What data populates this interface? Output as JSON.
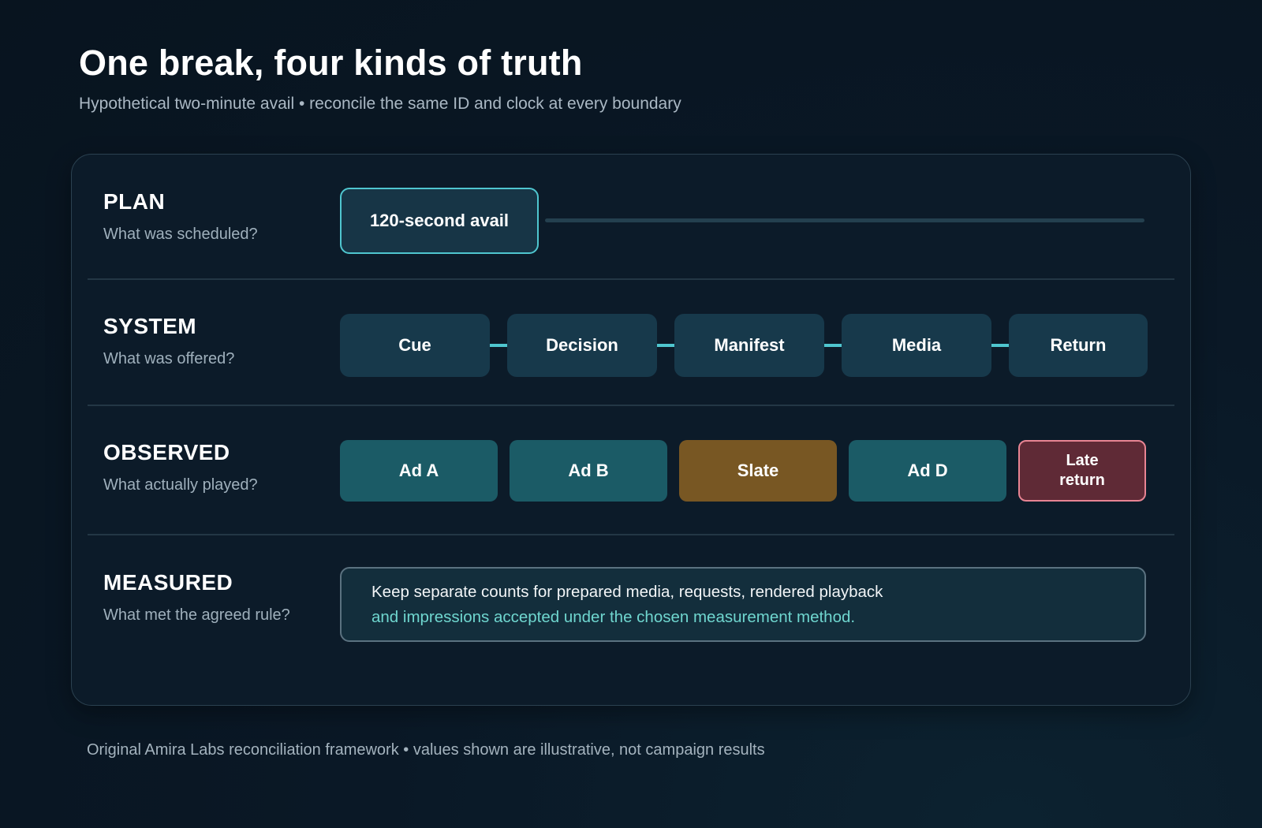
{
  "header": {
    "title": "One break, four kinds of truth",
    "subtitle": "Hypothetical two-minute avail • reconcile the same ID and clock at every boundary"
  },
  "rows": {
    "plan": {
      "name": "PLAN",
      "question": "What was scheduled?",
      "box": "120-second avail"
    },
    "system": {
      "name": "SYSTEM",
      "question": "What was offered?",
      "steps": [
        "Cue",
        "Decision",
        "Manifest",
        "Media",
        "Return"
      ]
    },
    "observed": {
      "name": "OBSERVED",
      "question": "What actually played?",
      "items": [
        "Ad A",
        "Ad B",
        "Slate",
        "Ad D"
      ],
      "late_line1": "Late",
      "late_line2": "return"
    },
    "measured": {
      "name": "MEASURED",
      "question": "What met the agreed rule?",
      "text_line1": "Keep separate counts for prepared media, requests, rendered playback",
      "text_line2": "and impressions accepted under the chosen measurement method."
    }
  },
  "footnote": "Original Amira Labs reconciliation framework • values shown are illustrative, not campaign results",
  "colors": {
    "accent_teal": "#4fc6cf",
    "slate_amber": "#785723",
    "late_red": "#e88493"
  }
}
